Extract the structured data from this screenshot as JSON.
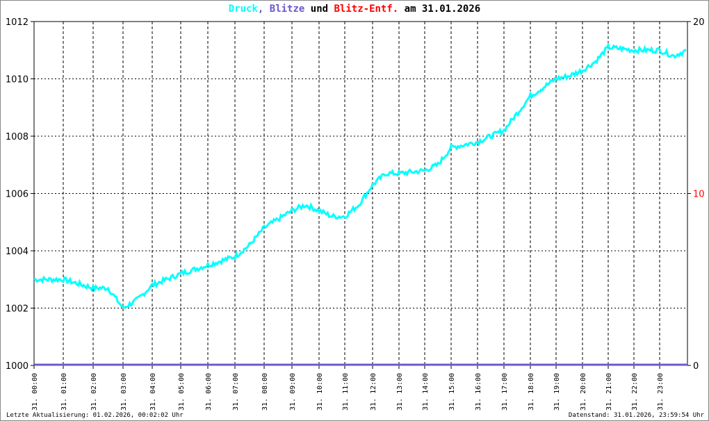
{
  "chart_data": {
    "type": "line",
    "title": {
      "part1": "Druck",
      "sep1": ", ",
      "part2": "Blitze",
      "sep2": " und ",
      "part3": "Blitz-Entf.",
      "sep3": " am 31.01.2026"
    },
    "colors": {
      "druck": "#00ffff",
      "blitze": "#6a5acd",
      "entf": "#ff0000"
    },
    "y_left": {
      "ylim": [
        1000,
        1012
      ],
      "ticks": [
        "1000",
        "1002",
        "1004",
        "1006",
        "1008",
        "1010",
        "1012"
      ]
    },
    "y_right": {
      "ylim": [
        0,
        20
      ],
      "ticks": [
        "0",
        "10",
        "20"
      ]
    },
    "x_ticks": [
      "31. 00:00",
      "31. 01:00",
      "31. 02:00",
      "31. 03:00",
      "31. 04:00",
      "31. 05:00",
      "31. 06:00",
      "31. 07:00",
      "31. 08:00",
      "31. 09:00",
      "31. 10:00",
      "31. 11:00",
      "31. 12:00",
      "31. 13:00",
      "31. 14:00",
      "31. 15:00",
      "31. 16:00",
      "31. 17:00",
      "31. 18:00",
      "31. 19:00",
      "31. 20:00",
      "31. 21:00",
      "31. 22:00",
      "31. 23:00"
    ],
    "series": [
      {
        "name": "Druck",
        "x_hours": [
          0,
          1,
          2,
          2.5,
          3,
          3.5,
          4,
          5,
          6,
          7,
          7.5,
          8,
          9,
          9.5,
          10,
          10.5,
          11,
          11.5,
          12,
          12.5,
          13,
          14,
          14.5,
          15,
          16,
          16.5,
          17,
          18,
          19,
          19.5,
          20,
          20.5,
          21,
          22,
          23,
          23.5,
          24
        ],
        "values": [
          1003.0,
          1003.0,
          1002.7,
          1002.7,
          1002.0,
          1002.3,
          1002.8,
          1003.2,
          1003.5,
          1003.8,
          1004.2,
          1004.8,
          1005.4,
          1005.6,
          1005.4,
          1005.2,
          1005.2,
          1005.6,
          1006.3,
          1006.7,
          1006.7,
          1006.8,
          1007.0,
          1007.6,
          1007.8,
          1008.0,
          1008.2,
          1009.4,
          1010.0,
          1010.1,
          1010.3,
          1010.6,
          1011.1,
          1011.0,
          1011.0,
          1010.8,
          1011.0
        ]
      },
      {
        "name": "Blitze",
        "values": [
          0
        ]
      }
    ]
  },
  "footer": {
    "left": "Letzte Aktualisierung: 01.02.2026, 00:02:02 Uhr",
    "right": "Datenstand: 31.01.2026, 23:59:54 Uhr"
  }
}
